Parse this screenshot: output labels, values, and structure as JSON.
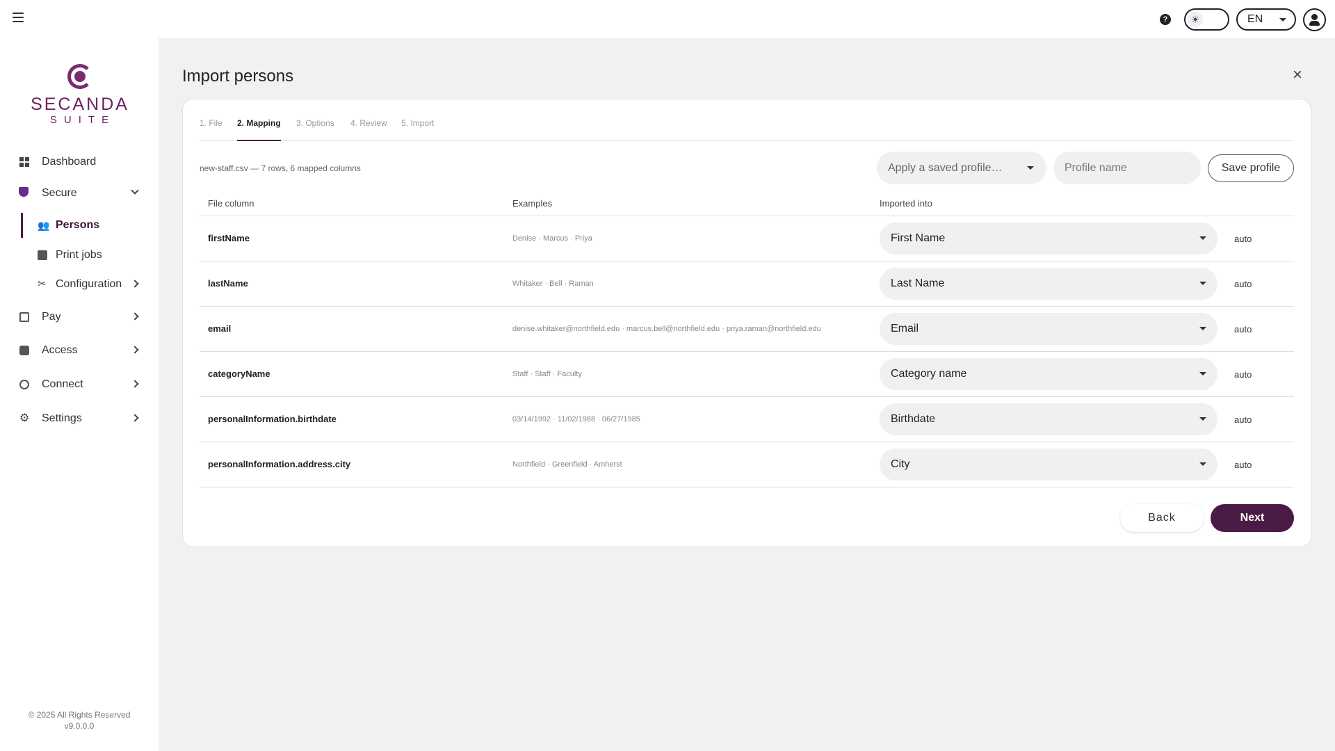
{
  "topbar": {
    "lang": "EN",
    "help_symbol": "?",
    "theme_symbol": "☀"
  },
  "brand": {
    "name": "SECANDA",
    "sub": "SUITE",
    "color": "#6b1f5f"
  },
  "nav": {
    "dashboard": "Dashboard",
    "secure": "Secure",
    "persons": "Persons",
    "print_jobs": "Print jobs",
    "configuration": "Configuration",
    "pay": "Pay",
    "access": "Access",
    "connect": "Connect",
    "settings": "Settings"
  },
  "footer": {
    "copyright": "© 2025 All Rights Reserved",
    "version": "v9.0.0.0"
  },
  "page": {
    "title": "Import persons",
    "close_symbol": "×"
  },
  "tabs": [
    "1. File",
    "2. Mapping",
    "3. Options",
    "4. Review",
    "5. Import"
  ],
  "active_tab": "2. Mapping",
  "file_info": "new-staff.csv — 7 rows, 6 mapped columns",
  "profile": {
    "select_placeholder": "Apply a saved profile…",
    "name_placeholder": "Profile name",
    "save_label": "Save profile"
  },
  "table": {
    "headers": {
      "file_column": "File column",
      "examples": "Examples",
      "imported_into": "Imported into"
    },
    "rows": [
      {
        "column": "firstName",
        "examples": "Denise · Marcus · Priya",
        "target": "First Name",
        "mode": "auto"
      },
      {
        "column": "lastName",
        "examples": "Whitaker · Bell · Raman",
        "target": "Last Name",
        "mode": "auto"
      },
      {
        "column": "email",
        "examples": "denise.whitaker@northfield.edu · marcus.bell@northfield.edu · priya.raman@northfield.edu",
        "target": "Email",
        "mode": "auto"
      },
      {
        "column": "categoryName",
        "examples": "Staff · Staff · Faculty",
        "target": "Category name",
        "mode": "auto"
      },
      {
        "column": "personalInformation.birthdate",
        "examples": "03/14/1992 · 11/02/1988 · 06/27/1985",
        "target": "Birthdate",
        "mode": "auto"
      },
      {
        "column": "personalInformation.address.city",
        "examples": "Northfield · Greenfield · Amherst",
        "target": "City",
        "mode": "auto"
      }
    ]
  },
  "actions": {
    "back": "Back",
    "next": "Next",
    "accent": "#4a1b45"
  }
}
